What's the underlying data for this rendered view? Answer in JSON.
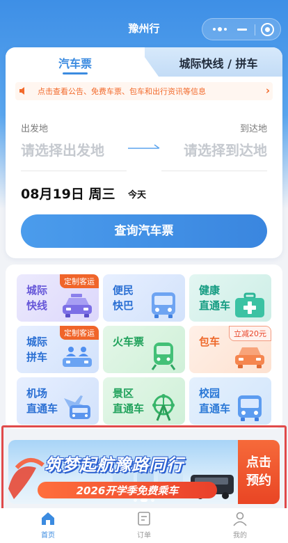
{
  "colors": {
    "accent": "#3b8be0",
    "notice": "#f26a2b",
    "badge": "#f0652a",
    "highlight_frame": "#e04a4a"
  },
  "navbar": {
    "title": "豫州行",
    "more_icon": "more-dots-icon",
    "minimize_icon": "minimize-icon",
    "close_icon": "target-close-icon"
  },
  "ticket": {
    "tabs": [
      {
        "label": "汽车票",
        "active": true
      },
      {
        "label": "城际快线 / 拼车",
        "active": false
      }
    ],
    "notice": {
      "icon": "speaker-icon",
      "text": "点击查看公告、免费车票、包车和出行资讯等信息",
      "arrow_icon": "chevron-right-icon"
    },
    "from_label": "出发地",
    "to_label": "到达地",
    "from_placeholder": "请选择出发地",
    "to_placeholder": "请选择到达地",
    "date": "08月19日 周三",
    "date_tag": "今天",
    "query_button": "查询汽车票"
  },
  "services": [
    {
      "label": "城际\n快线",
      "badge": "定制客运",
      "icon": "taxi-icon"
    },
    {
      "label": "便民\n快巴",
      "badge": "",
      "icon": "bus-icon"
    },
    {
      "label": "健康\n直通车",
      "badge": "",
      "icon": "medical-kit-icon"
    },
    {
      "label": "城际\n拼车",
      "badge": "定制客运",
      "icon": "carpool-icon"
    },
    {
      "label": "火车票",
      "badge": "",
      "icon": "train-icon"
    },
    {
      "label": "包车",
      "badge": "立减20元",
      "icon": "car-icon"
    },
    {
      "label": "机场\n直通车",
      "badge": "",
      "icon": "airport-bus-icon"
    },
    {
      "label": "景区\n直通车",
      "badge": "",
      "icon": "ferris-wheel-icon"
    },
    {
      "label": "校园\n直通车",
      "badge": "",
      "icon": "school-bus-icon"
    }
  ],
  "banner": {
    "title": "筑梦起航豫路同行",
    "subtitle": "2026开学季免费乘车",
    "cta": "点击\n预约"
  },
  "tabbar": [
    {
      "label": "首页",
      "icon": "home-icon",
      "active": true
    },
    {
      "label": "订单",
      "icon": "order-icon",
      "active": false
    },
    {
      "label": "我的",
      "icon": "user-icon",
      "active": false
    }
  ]
}
